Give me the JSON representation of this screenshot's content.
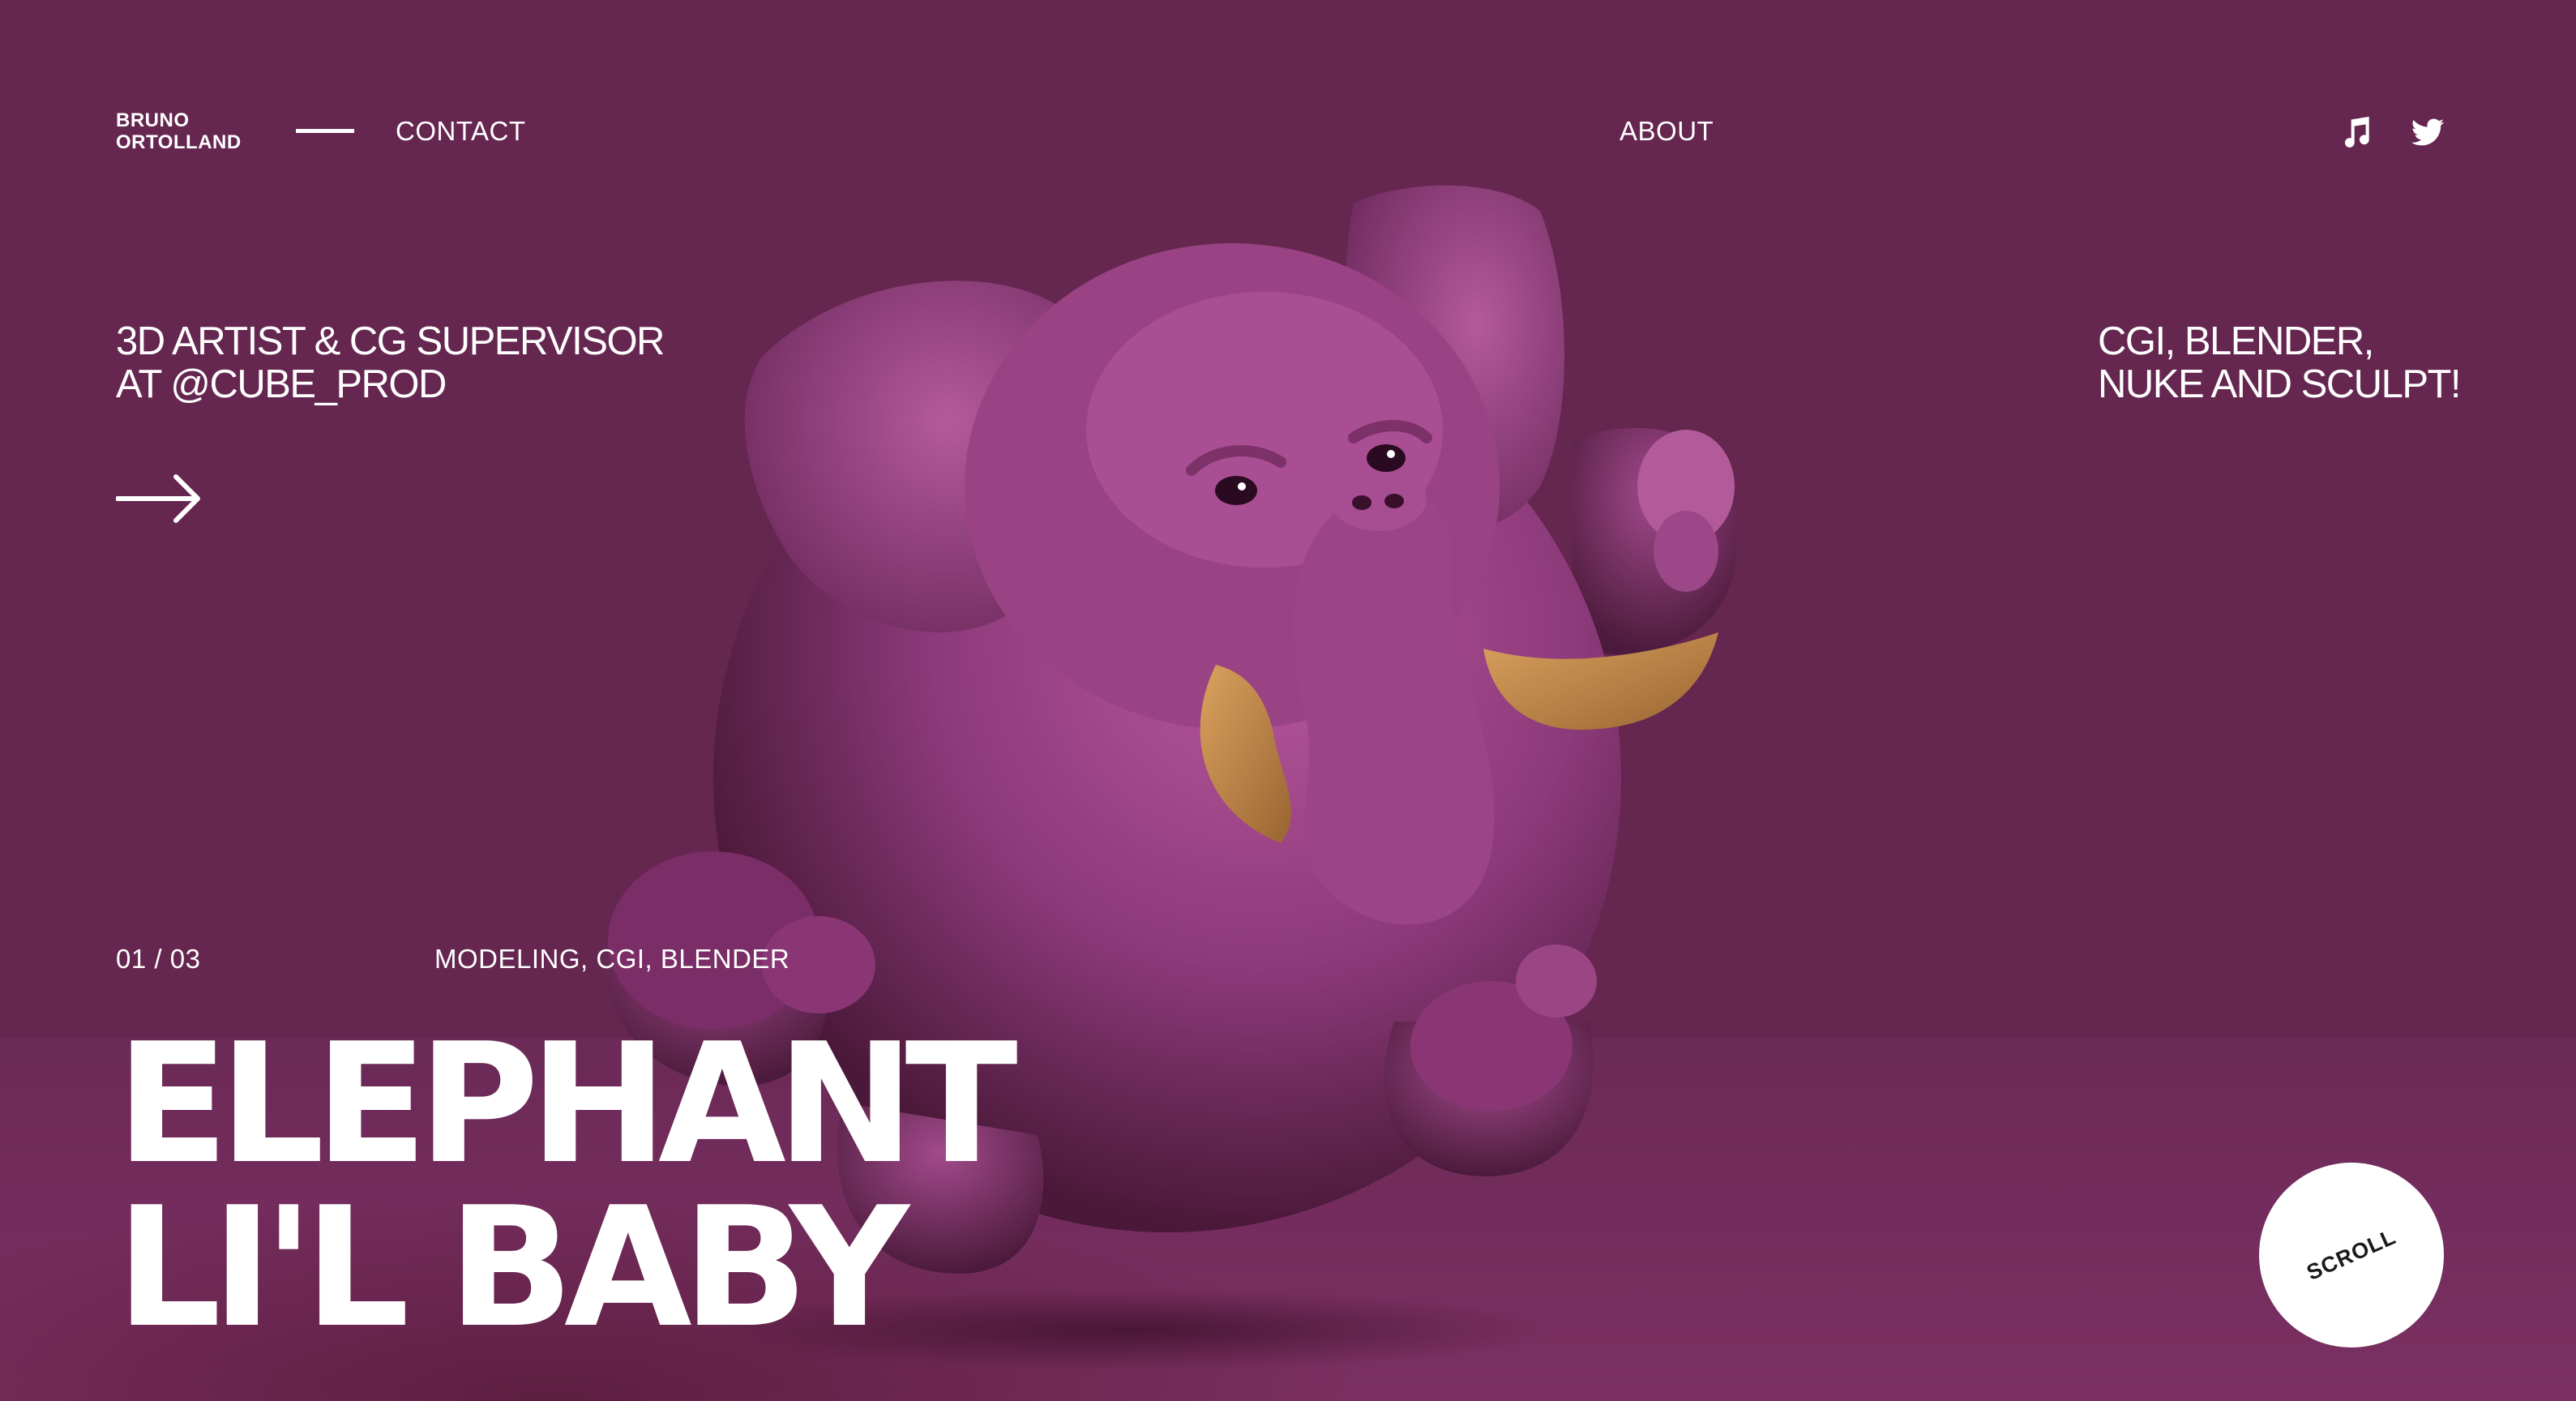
{
  "brand": {
    "line1": "BRUNO",
    "line2": "ORTOLLAND"
  },
  "nav": {
    "contact": "CONTACT",
    "about": "ABOUT",
    "icons": [
      "music-note-icon",
      "twitter-icon"
    ]
  },
  "intro": {
    "left_line1": "3D ARTIST & CG SUPERVISOR",
    "left_line2": "AT @CUBE_PROD",
    "right_line1": "CGI, BLENDER,",
    "right_line2": "NUKE AND SCULPT!"
  },
  "project": {
    "counter": "01 / 03",
    "categories": "MODELING, CGI, BLENDER",
    "title_line1": "ELEPHANT",
    "title_line2": "LI'L BABY",
    "image": "pink-elephant-3d-render"
  },
  "scroll": {
    "label": "SCROLL"
  },
  "colors": {
    "background": "#65264f",
    "floor": "#732c5d",
    "elephant": "#a84a8f",
    "tusk": "#c98a4a",
    "text": "#ffffff",
    "scroll_button": "#ffffff",
    "scroll_text": "#1b1b1b"
  }
}
